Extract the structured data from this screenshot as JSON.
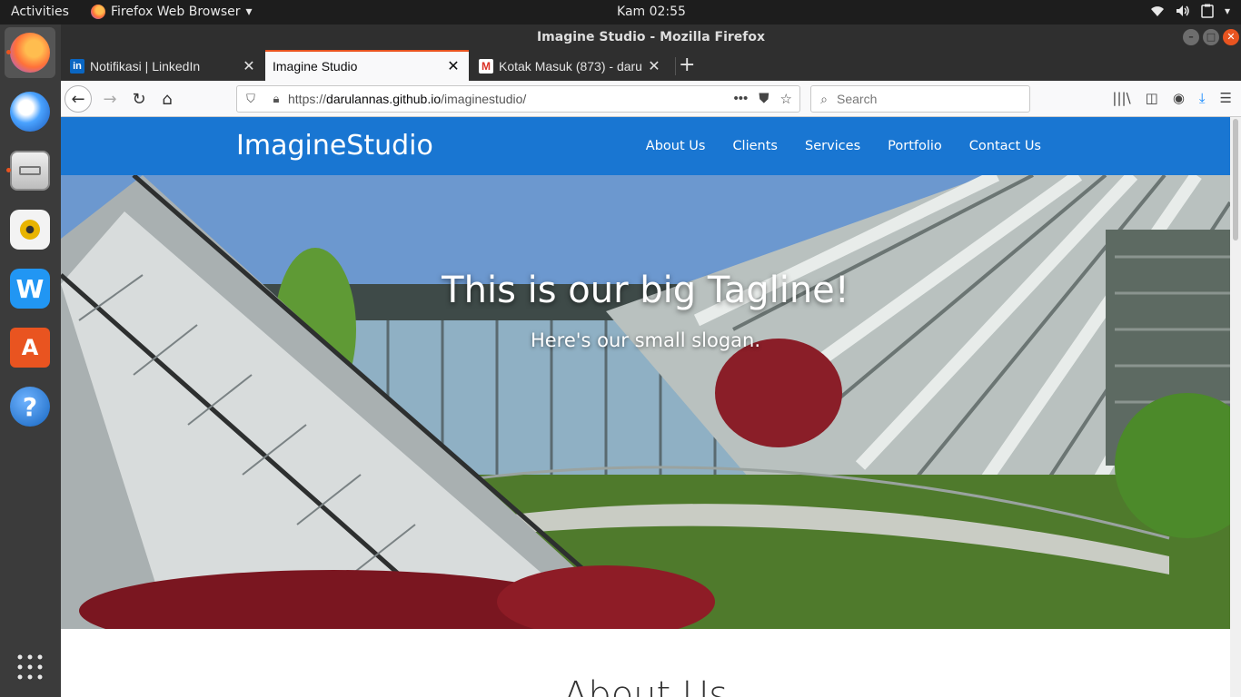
{
  "topbar": {
    "activities": "Activities",
    "app_name": "Firefox Web Browser",
    "clock": "Kam 02:55"
  },
  "dock": {
    "items": [
      "firefox-icon",
      "thunderbird-icon",
      "files-icon",
      "rhythmbox-icon",
      "wps-writer-icon",
      "software-center-icon",
      "help-icon",
      "show-apps-icon"
    ]
  },
  "window": {
    "title": "Imagine Studio - Mozilla Firefox"
  },
  "tabs": [
    {
      "label": "Notifikasi | LinkedIn",
      "favicon": "in"
    },
    {
      "label": "Imagine Studio",
      "favicon": ""
    },
    {
      "label": "Kotak Masuk (873) - daru",
      "favicon": "M"
    }
  ],
  "navbar": {
    "url_prefix": "https://",
    "url_host": "darulannas.github.io",
    "url_path": "/imaginestudio/",
    "search_placeholder": "Search"
  },
  "site": {
    "brand": "ImagineStudio",
    "menu": [
      "About Us",
      "Clients",
      "Services",
      "Portfolio",
      "Contact Us"
    ],
    "tagline": "This is our big Tagline!",
    "slogan": "Here's our small slogan.",
    "about_title": "About Us"
  },
  "colors": {
    "brand_blue": "#1976d2",
    "ubuntu_orange": "#e95420"
  }
}
